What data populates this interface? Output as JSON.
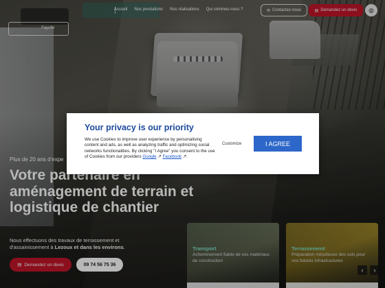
{
  "header": {
    "logo_text": "Fayolle",
    "nav": [
      "Accueil",
      "Nos prestations",
      "Nos réalisations",
      "Qui sommes-nous ?"
    ],
    "contact_label": "Contactez-nous",
    "devis_label": "Demandez un devis"
  },
  "hero": {
    "eyebrow": "Plus de 20 ans d'expe",
    "title": "Votre partenaire en aménagement de terrain et logistique de chantier",
    "desc_1": "Nous effectuons des travaux de terrassement et d'assainissement à ",
    "desc_bold": "Lezoux et dans les environs",
    "desc_end": ".",
    "devis_label": "Demandez un devis",
    "phone": "09 74 56 75 36"
  },
  "cards": [
    {
      "title": "Transport",
      "text": "Acheminement fiable de vos matériaux de construction"
    },
    {
      "title": "Terrassement",
      "text": "Préparation minutieuse des sols pour vos futures infrastructures"
    }
  ],
  "slider": {
    "prev": "‹",
    "next": "›"
  },
  "privacy": {
    "title": "Your privacy is our priority",
    "body": "We use Cookies to improve user experience by personalising content and ads, as well as analyzing traffic and optimizing social networks functionalities. By clicking \"I Agree\" you consent to the use of Cookies from our providers ",
    "link_google": "Google",
    "link_facebook": "Facebook",
    "body_end": ".",
    "customize_label": "Customize",
    "agree_label": "I AGREE"
  },
  "colors": {
    "accent_red": "#c3162a",
    "privacy_blue": "#2d67c9",
    "title_blue": "#1c4a9e",
    "card_title": "#7fe0c7"
  },
  "icons": [
    "mail-icon",
    "quote-icon",
    "phone-icon",
    "globe-icon",
    "external-link-icon"
  ]
}
